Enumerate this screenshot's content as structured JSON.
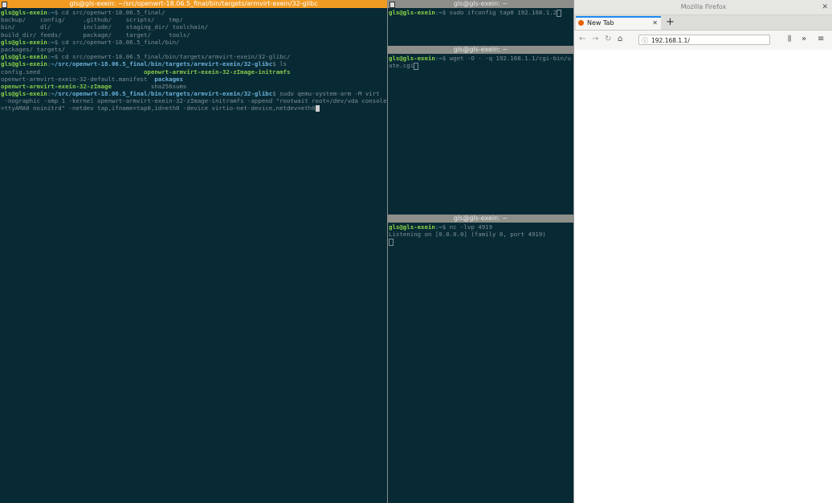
{
  "main_terminal": {
    "title": "gls@gls-exein: ~/src/openwrt-18.06.5_final/bin/targets/armvirt-exein/32-glibc",
    "lines": [
      [
        {
          "t": "gls@gls-exein",
          "c": "u"
        },
        {
          "t": ":"
        },
        {
          "t": "~",
          "c": "p"
        },
        {
          "t": "$ cd src/openwrt-18.06.5_final/"
        }
      ],
      [
        {
          "t": "backup/    config/     .github/    scripts/    tmp/"
        }
      ],
      [
        {
          "t": "bin/       dl/         include/    staging_dir/ toolchain/"
        }
      ],
      [
        {
          "t": "build_dir/ feeds/      package/    target/     tools/"
        }
      ],
      [
        {
          "t": "gls@gls-exein",
          "c": "u"
        },
        {
          "t": ":"
        },
        {
          "t": "~",
          "c": "p"
        },
        {
          "t": "$ cd src/openwrt-18.06.5_final/bin/"
        }
      ],
      [
        {
          "t": "packages/ targets/"
        }
      ],
      [
        {
          "t": "gls@gls-exein",
          "c": "u"
        },
        {
          "t": ":"
        },
        {
          "t": "~",
          "c": "p"
        },
        {
          "t": "$ cd src/openwrt-18.06.5_final/bin/targets/armvirt-exein/32-glibc/"
        }
      ],
      [
        {
          "t": "gls@gls-exein",
          "c": "u"
        },
        {
          "t": ":"
        },
        {
          "t": "~/src/openwrt-18.06.5_final/bin/targets/armvirt-exein/32-glibc",
          "c": "p"
        },
        {
          "t": "$ ls"
        }
      ],
      [
        {
          "t": "config.seed                             "
        },
        {
          "t": "openwrt-armvirt-exein-32-zImage-initramfs",
          "c": "g"
        }
      ],
      [
        {
          "t": "openwrt-armvirt-exein-32-default.manifest  "
        },
        {
          "t": "packages",
          "c": "p"
        }
      ],
      [
        {
          "t": "openwrt-armvirt-exein-32-zImage",
          "c": "g"
        },
        {
          "t": "           sha256sums"
        }
      ],
      [
        {
          "t": "gls@gls-exein",
          "c": "u"
        },
        {
          "t": ":"
        },
        {
          "t": "~/src/openwrt-18.06.5_final/bin/targets/armvirt-exein/32-glibc",
          "c": "p"
        },
        {
          "t": "$ sudo qemu-system-arm -M virt"
        }
      ],
      [
        {
          "t": " -nographic -smp 1 -kernel openwrt-armvirt-exein-32-zImage-initramfs -append \"rootwait root=/dev/vda console"
        }
      ],
      [
        {
          "t": "=ttyAMA0 noinitrd\" -netdev tap,ifname=tap0,id=eth0 -device virtio-net-device,netdev=eth0"
        }
      ]
    ]
  },
  "top_right_terminal": {
    "title": "gls@gls-exein: ~",
    "lines": [
      [
        {
          "t": "gls@gls-exein",
          "c": "u"
        },
        {
          "t": ":"
        },
        {
          "t": "~",
          "c": "p"
        },
        {
          "t": "$ sudo ifconfig tap0 192.168.1.2"
        }
      ]
    ]
  },
  "middle_right_terminal": {
    "title": "gls@gls-exein: ~",
    "lines": [
      [
        {
          "t": "gls@gls-exein",
          "c": "u"
        },
        {
          "t": ":"
        },
        {
          "t": "~",
          "c": "p"
        },
        {
          "t": "$ wget -O - -q 192.168.1.1/cgi-bin/u"
        }
      ],
      [
        {
          "t": "ate.cgi"
        }
      ]
    ]
  },
  "bottom_right_terminal": {
    "title": "gls@gls-exein: ~",
    "lines": [
      [
        {
          "t": "gls@gls-exein",
          "c": "u"
        },
        {
          "t": ":"
        },
        {
          "t": "~",
          "c": "p"
        },
        {
          "t": "$ nc -lvp 4919"
        }
      ],
      [
        {
          "t": "Listening on [0.0.0.0] (family 0, port 4919)"
        }
      ]
    ]
  },
  "firefox": {
    "window_title": "Mozilla Firefox",
    "tab_label": "New Tab",
    "url": "192.168.1.1/"
  }
}
